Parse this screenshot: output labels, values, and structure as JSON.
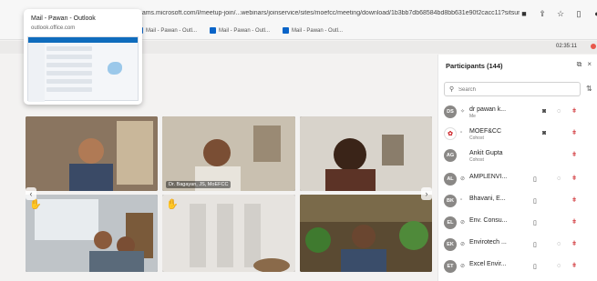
{
  "browser": {
    "url": "teams.microsoft.com/l/meetup-join/...webinars/joinservice/sites/moefcc/meeting/download/1b3bb7db68584bd8bb631e90f2cacc11?sitsurl=moefcc&MTID=m123d5164...",
    "bookmarks": [
      "Mail - Pawan - Outl...",
      "Mail - Pawan - Outl...",
      "Mail - Pawan - Outl..."
    ],
    "icons": [
      "video-icon",
      "share-icon",
      "star-icon",
      "split-icon",
      "profile-icon"
    ]
  },
  "meeting": {
    "timer": "02:35:11"
  },
  "tab_preview": {
    "title": "Mail - Pawan - Outlook",
    "url": "outlook.office.com"
  },
  "tiles": [
    {
      "label": "",
      "hand": false
    },
    {
      "label": "Dr. Bagayan, JS, MoEFCC",
      "hand": false
    },
    {
      "label": "",
      "hand": false
    },
    {
      "label": "",
      "hand": true
    },
    {
      "label": "",
      "hand": true
    },
    {
      "label": "",
      "hand": false
    }
  ],
  "participants_panel": {
    "title": "Participants (144)",
    "search_placeholder": "Search",
    "rows": [
      {
        "initials": "DS",
        "name": "dr pawan k...",
        "sub": "Me"
      },
      {
        "initials": "",
        "name": "MOEF&CC",
        "sub": "Cohost"
      },
      {
        "initials": "AG",
        "name": "Ankit Gupta",
        "sub": "Cohost"
      },
      {
        "initials": "AL",
        "name": "AMPLENVI...",
        "sub": ""
      },
      {
        "initials": "BK",
        "name": "Bhavani, E...",
        "sub": ""
      },
      {
        "initials": "EL",
        "name": "Env. Consu...",
        "sub": ""
      },
      {
        "initials": "EK",
        "name": "Envirotech ...",
        "sub": ""
      },
      {
        "initials": "ET",
        "name": "Excel Envir...",
        "sub": ""
      }
    ]
  },
  "colors": {
    "accent": "#0f6cbd",
    "mic_muted": "#d13438",
    "recording": "#e8584c",
    "hand": "#f5c518"
  }
}
